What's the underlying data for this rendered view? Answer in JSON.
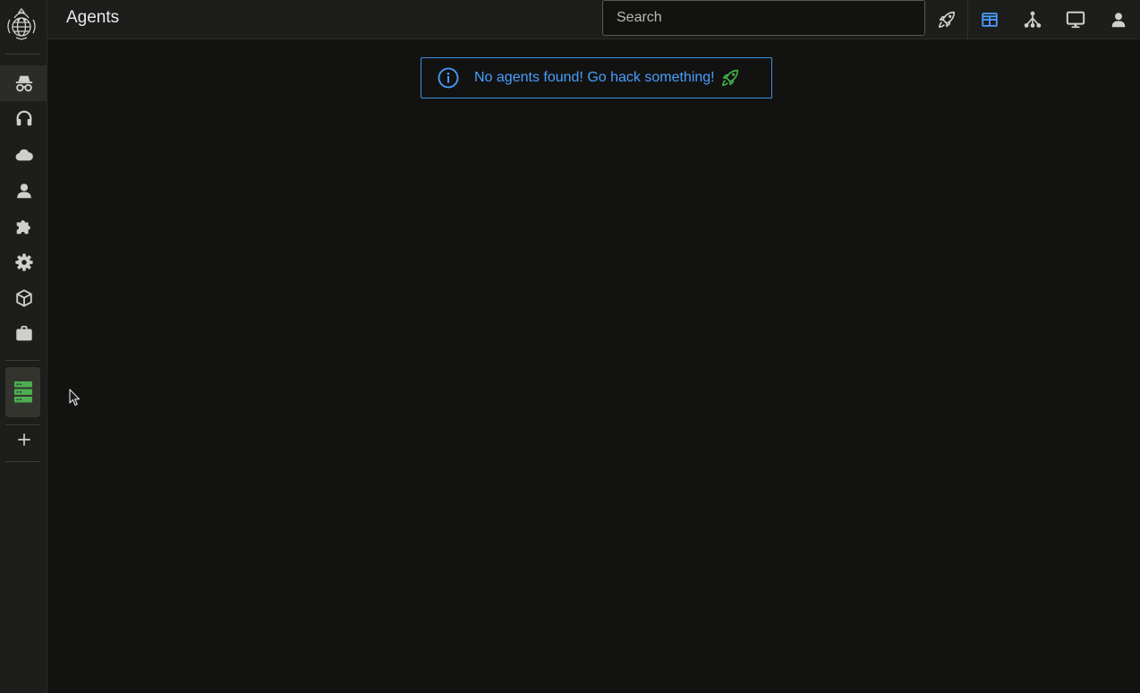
{
  "header": {
    "title": "Agents",
    "search_placeholder": "Search"
  },
  "sidebar": {
    "items": [
      {
        "name": "agents",
        "icon": "spy-icon",
        "active": true
      },
      {
        "name": "listeners",
        "icon": "headphones-icon"
      },
      {
        "name": "cloud",
        "icon": "cloud-icon"
      },
      {
        "name": "users",
        "icon": "user-icon"
      },
      {
        "name": "extensions",
        "icon": "puzzle-icon"
      },
      {
        "name": "settings",
        "icon": "gear-icon"
      },
      {
        "name": "payloads",
        "icon": "box-icon"
      },
      {
        "name": "jobs",
        "icon": "briefcase-icon"
      }
    ],
    "server_icon": "server-icon",
    "add_icon": "plus-icon"
  },
  "toolbar": {
    "icons": [
      "rocket-icon",
      "table-view-icon",
      "graph-view-icon",
      "monitor-icon",
      "user-icon"
    ]
  },
  "alert": {
    "message": "No agents found! Go hack something!",
    "icon": "info-icon",
    "trailing_icon": "rocket-icon"
  },
  "colors": {
    "accent": "#4a9eff",
    "server_green": "#4caf50",
    "rocket_green": "#43b049",
    "icon_gray": "#cfcfcc"
  }
}
